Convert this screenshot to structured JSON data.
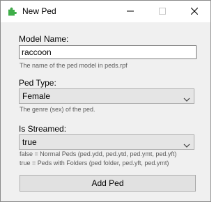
{
  "window": {
    "title": "New Ped"
  },
  "model_name": {
    "label": "Model Name:",
    "value": "raccoon",
    "hint": "The name of the ped model in peds.rpf"
  },
  "ped_type": {
    "label": "Ped Type:",
    "selected": "Female",
    "hint": "The genre (sex) of the ped."
  },
  "is_streamed": {
    "label": "Is Streamed:",
    "selected": "true",
    "hint_false": "false = Normal Peds (ped.ydd, ped.ytd, ped.ymt, ped.yft)",
    "hint_true": "true = Peds with Folders (ped folder, ped.yft, ped.ymt)"
  },
  "actions": {
    "add_label": "Add Ped"
  },
  "icons": {
    "app": "green-puzzle-icon",
    "minimize": "minimize-icon",
    "maximize": "maximize-icon",
    "close": "close-icon",
    "dropdown": "chevron-down-icon"
  },
  "colors": {
    "window_bg": "#f0f0f0",
    "titlebar_bg": "#ffffff",
    "app_icon": "#3fae49"
  }
}
